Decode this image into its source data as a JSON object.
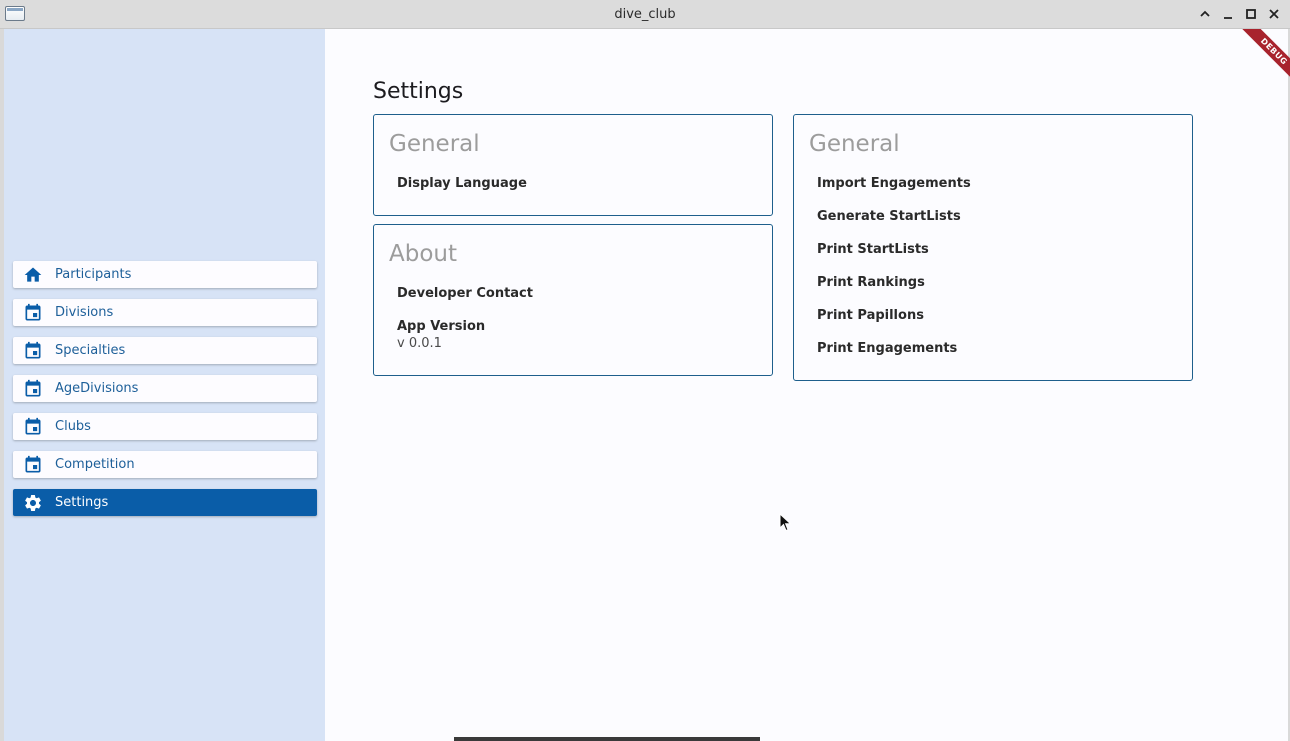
{
  "window": {
    "title": "dive_club",
    "controls": [
      "chevron-up-icon",
      "minimize-icon",
      "maximize-icon",
      "close-icon"
    ]
  },
  "debug_banner": "DEBUG",
  "sidebar": {
    "items": [
      {
        "label": "Participants",
        "icon": "home-icon",
        "active": false
      },
      {
        "label": "Divisions",
        "icon": "calendar-icon",
        "active": false
      },
      {
        "label": "Specialties",
        "icon": "calendar-icon",
        "active": false
      },
      {
        "label": "AgeDivisions",
        "icon": "calendar-icon",
        "active": false
      },
      {
        "label": "Clubs",
        "icon": "calendar-icon",
        "active": false
      },
      {
        "label": "Competition",
        "icon": "calendar-icon",
        "active": false
      },
      {
        "label": "Settings",
        "icon": "gear-icon",
        "active": true
      }
    ]
  },
  "main": {
    "page_title": "Settings",
    "general_left": {
      "title": "General",
      "items": [
        "Display Language"
      ]
    },
    "about": {
      "title": "About",
      "developer_contact": "Developer Contact",
      "app_version_label": "App Version",
      "app_version_value": "v 0.0.1"
    },
    "general_right": {
      "title": "General",
      "items": [
        "Import Engagements",
        "Generate StartLists",
        "Print StartLists",
        "Print Rankings",
        "Print Papillons",
        "Print Engagements"
      ]
    }
  },
  "colors": {
    "accent": "#0a5da8",
    "sidebar_bg": "#d7e3f6",
    "card_border": "#1e5f8c",
    "nav_text": "#1d5f99",
    "debug": "#a8232d"
  }
}
